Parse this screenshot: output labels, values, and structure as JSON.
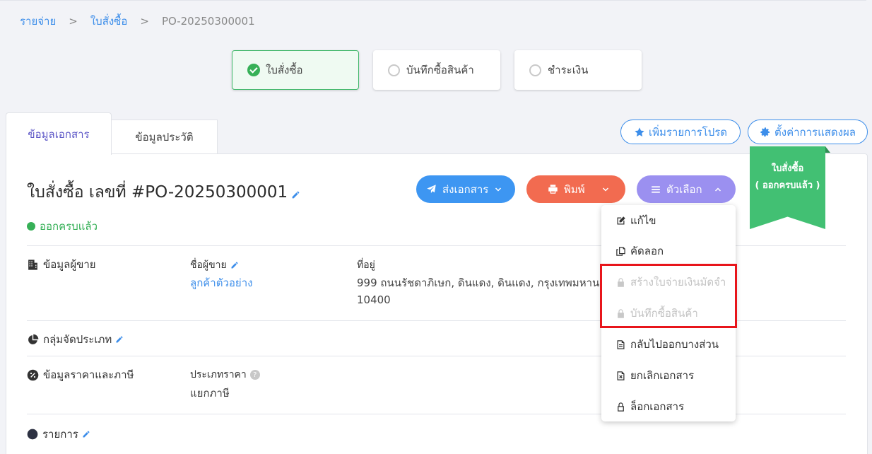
{
  "breadcrumb": {
    "root": "รายจ่าย",
    "parent": "ใบสั่งซื้อ",
    "current": "PO-20250300001",
    "separator": ">"
  },
  "steps": [
    {
      "label": "ใบสั่งซื้อ",
      "state": "done"
    },
    {
      "label": "บันทึกซื้อสินค้า",
      "state": "pending"
    },
    {
      "label": "ชำระเงิน",
      "state": "pending"
    }
  ],
  "tabs": {
    "doc_info": "ข้อมูลเอกสาร",
    "history": "ข้อมูลประวัติ"
  },
  "header_actions": {
    "add_favorite": "เพิ่มรายการโปรด",
    "display_settings": "ตั้งค่าการแสดงผล"
  },
  "document": {
    "title": "ใบสั่งซื้อ เลขที่ #PO-20250300001",
    "status": "ออกครบแล้ว"
  },
  "buttons": {
    "send": "ส่งเอกสาร",
    "print": "พิมพ์",
    "options": "ตัวเลือก"
  },
  "ribbon": {
    "line1": "ใบสั่งซื้อ",
    "line2": "( ออกครบแล้ว )"
  },
  "vendor": {
    "section_label": "ข้อมูลผู้ขาย",
    "name_label": "ชื่อผู้ขาย",
    "name_value": "ลูกค้าตัวอย่าง",
    "address_label": "ที่อยู่",
    "address_line1": "999 ถนนรัชดาภิเษก, ดินแดง, ดินแดง, กรุงเทพมหานคร",
    "address_line2": "10400"
  },
  "category": {
    "section_label": "กลุ่มจัดประเภท"
  },
  "pricing": {
    "section_label": "ข้อมูลราคาและภาษี",
    "price_type_label": "ประเภทราคา",
    "price_type_value": "แยกภาษี"
  },
  "items": {
    "section_label": "รายการ"
  },
  "options_menu": {
    "items": [
      {
        "label": "แก้ไข",
        "icon": "edit-icon",
        "disabled": false
      },
      {
        "label": "คัดลอก",
        "icon": "copy-icon",
        "disabled": false
      },
      {
        "label": "สร้างใบจ่ายเงินมัดจำ",
        "icon": "lock-icon",
        "disabled": true
      },
      {
        "label": "บันทึกซื้อสินค้า",
        "icon": "lock-icon",
        "disabled": true
      },
      {
        "label": "กลับไปออกบางส่วน",
        "icon": "document-icon",
        "disabled": false
      },
      {
        "label": "ยกเลิกเอกสาร",
        "icon": "cancel-document-icon",
        "disabled": false
      },
      {
        "label": "ล็อกเอกสาร",
        "icon": "padlock-icon",
        "disabled": false
      }
    ]
  },
  "colors": {
    "primary": "#3d8eea",
    "success": "#36b057",
    "danger": "#f26b50",
    "violet": "#9b90f0",
    "highlight": "#e8151b"
  }
}
